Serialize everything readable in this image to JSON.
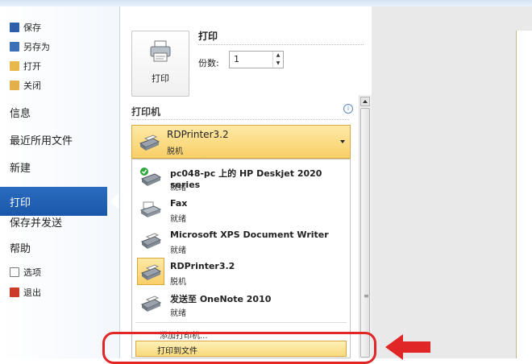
{
  "nav": {
    "save": "保存",
    "save_as": "另存为",
    "open": "打开",
    "close": "关闭",
    "info": "信息",
    "recent": "最近所用文件",
    "new": "新建",
    "print": "打印",
    "save_send": "保存并发送",
    "help": "帮助",
    "options": "选项",
    "exit": "退出"
  },
  "print": {
    "button_label": "打印",
    "title": "打印",
    "copies_label": "份数:",
    "copies_value": "1"
  },
  "printer_section": {
    "header": "打印机",
    "selected": {
      "name": "RDPrinter3.2",
      "status": "脱机"
    },
    "items": [
      {
        "name": "pc048-pc 上的 HP Deskjet 2020 series",
        "status": "就绪",
        "icon": "printer-default-icon"
      },
      {
        "name": "Fax",
        "status": "就绪",
        "icon": "fax-icon"
      },
      {
        "name": "Microsoft XPS Document Writer",
        "status": "就绪",
        "icon": "printer-icon"
      },
      {
        "name": "RDPrinter3.2",
        "status": "脱机",
        "icon": "printer-icon"
      },
      {
        "name": "发送至 OneNote 2010",
        "status": "就绪",
        "icon": "printer-icon"
      }
    ],
    "add_printer": "添加打印机...",
    "print_to_file": "打印到文件"
  },
  "colors": {
    "nav_selected": "#1a57a8",
    "highlight": "#f9cf67",
    "annotation": "#e02626"
  }
}
